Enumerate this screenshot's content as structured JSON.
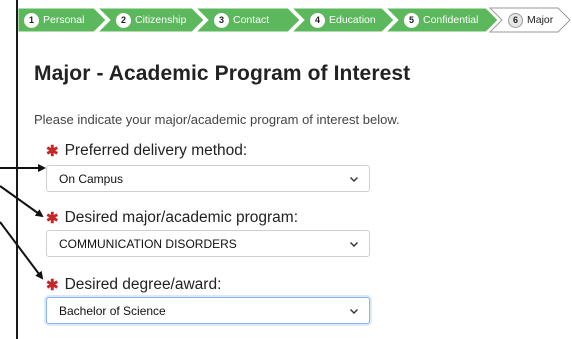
{
  "steps": [
    {
      "num": "1",
      "label": "Personal"
    },
    {
      "num": "2",
      "label": "Citizenship"
    },
    {
      "num": "3",
      "label": "Contact"
    },
    {
      "num": "4",
      "label": "Education"
    },
    {
      "num": "5",
      "label": "Confidential"
    },
    {
      "num": "6",
      "label": "Major"
    }
  ],
  "colors": {
    "step_green": "#5cb85c",
    "step_active": "#ffffff",
    "required": "#c62828"
  },
  "page": {
    "title": "Major - Academic Program of Interest",
    "intro": "Please indicate your major/academic program of interest below."
  },
  "fields": {
    "delivery": {
      "label": "Preferred delivery method:",
      "value": "On Campus"
    },
    "major": {
      "label": "Desired major/academic program:",
      "value": "COMMUNICATION DISORDERS"
    },
    "degree": {
      "label": "Desired degree/award:",
      "value": "Bachelor of Science"
    }
  },
  "required_mark": "✱"
}
